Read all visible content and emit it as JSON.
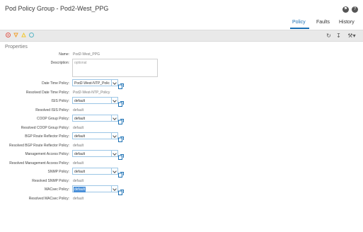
{
  "window_title": "Pod Policy Group - Pod2-West_PPG",
  "tabs": [
    {
      "label": "Policy"
    },
    {
      "label": "Faults"
    },
    {
      "label": "History"
    }
  ],
  "section": "Properties",
  "name": {
    "label": "Name:",
    "value": "Pod2-West_PPG"
  },
  "description": {
    "label": "Description:",
    "placeholder": "optional"
  },
  "rows": [
    {
      "label": "Date Time Policy:",
      "value": "Pod2-West-NTP_Polic"
    },
    {
      "label": "Resolved Date Time Policy:",
      "value": "Pod2-West-NTP_Policy"
    },
    {
      "label": "ISIS Policy:",
      "value": "default"
    },
    {
      "label": "Resolved ISIS Policy:",
      "value": "default"
    },
    {
      "label": "COOP Group Policy:",
      "value": "default"
    },
    {
      "label": "Resolved COOP Group Policy:",
      "value": "default"
    },
    {
      "label": "BGP Route Reflector Policy:",
      "value": "default"
    },
    {
      "label": "Resolved BGP Route Reflector Policy:",
      "value": "default"
    },
    {
      "label": "Management Access Policy:",
      "value": "default"
    },
    {
      "label": "Resolved Management Access Policy:",
      "value": "default"
    },
    {
      "label": "SNMP Policy:",
      "value": "default"
    },
    {
      "label": "Resolved SNMP Policy:",
      "value": "default"
    },
    {
      "label": "MACsec Policy:",
      "value": "default"
    },
    {
      "label": "Resolved MACsec Policy:",
      "value": "default"
    }
  ],
  "colors": {
    "accent": "#1a6fb3",
    "fault_red": "#e05a4f",
    "fault_orange": "#f0a030",
    "fault_yellow": "#f2c830",
    "fault_teal": "#58b6c6"
  },
  "icons": {
    "header": [
      "bookmark-icon",
      "help-icon"
    ],
    "toolbar_left": [
      "critical-fault-icon",
      "major-fault-icon",
      "minor-fault-icon",
      "warning-fault-icon"
    ],
    "toolbar_right": [
      "refresh-icon",
      "download-icon",
      "tools-icon"
    ]
  }
}
